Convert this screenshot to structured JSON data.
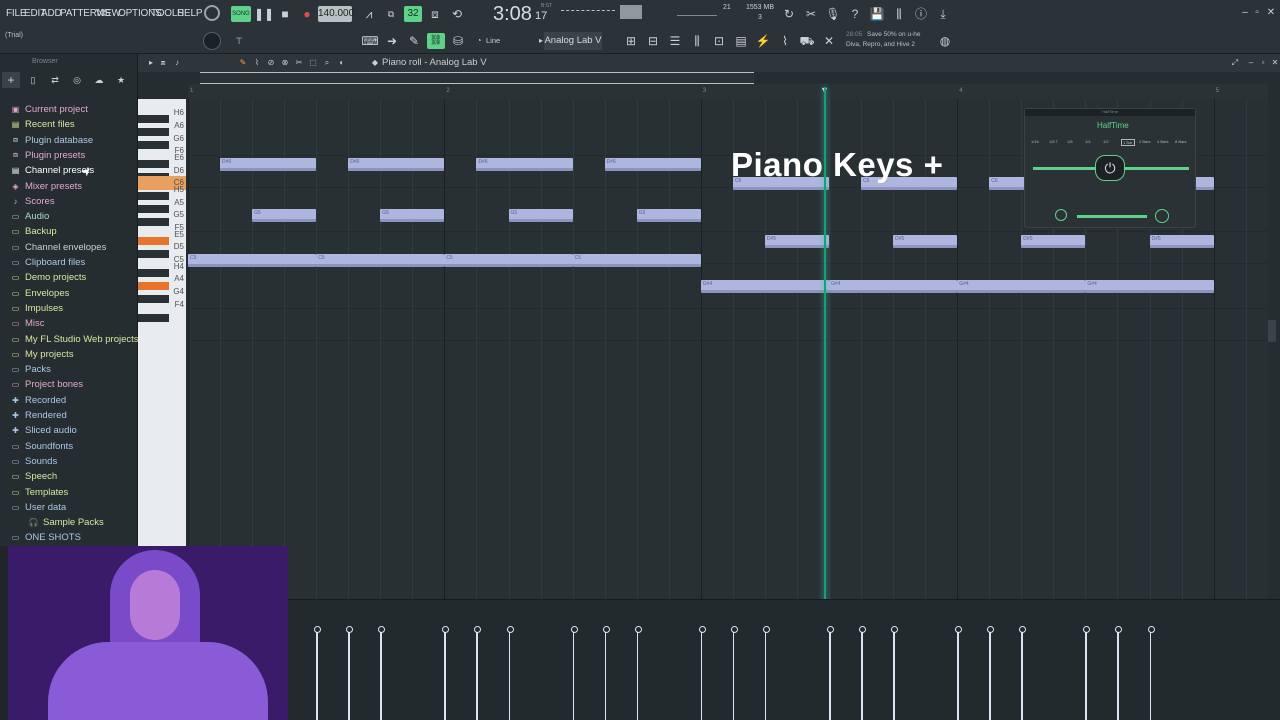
{
  "menu": [
    "FILE",
    "EDIT",
    "ADD",
    "PATTERNS",
    "VIEW",
    "OPTIONS",
    "TOOLS",
    "HELP"
  ],
  "transport": {
    "song_label": "SONG",
    "tempo": "140.000",
    "time": "3:08",
    "time_frac": "17",
    "time_unit": "B:ST",
    "memory": "1553 MB",
    "cpu": "21",
    "poly": "3",
    "snap": "32"
  },
  "trial": "(Trial)",
  "toolbar": {
    "snap_mode": "Line",
    "instrument": "Analog Lab V",
    "hint_time": "28:05",
    "hint_text": "Save 50% on u-he",
    "hint_text2": "Diva, Repro, and Hive 2"
  },
  "browser": {
    "header": "Browser",
    "items": [
      {
        "label": "Current project",
        "icon": "project-icon",
        "color": "#e2a9c8"
      },
      {
        "label": "Recent files",
        "icon": "recent-icon",
        "color": "#d7e6a0"
      },
      {
        "label": "Plugin database",
        "icon": "plug-icon",
        "color": "#a9c8e6"
      },
      {
        "label": "Plugin presets",
        "icon": "plug-icon",
        "color": "#e2a9c8"
      },
      {
        "label": "Channel presets",
        "icon": "channel-icon",
        "color": "#ffffff"
      },
      {
        "label": "Mixer presets",
        "icon": "mixer-icon",
        "color": "#e2a9c8"
      },
      {
        "label": "Scores",
        "icon": "score-icon",
        "color": "#e2a9c8"
      },
      {
        "label": "Audio",
        "icon": "folder-icon",
        "color": "#a9d9c8"
      },
      {
        "label": "Backup",
        "icon": "folder-icon",
        "color": "#d7e6a0"
      },
      {
        "label": "Channel envelopes",
        "icon": "folder-icon",
        "color": "#c8d0d4"
      },
      {
        "label": "Clipboard files",
        "icon": "folder-icon",
        "color": "#a9c8e6"
      },
      {
        "label": "Demo projects",
        "icon": "folder-icon",
        "color": "#d7e6a0"
      },
      {
        "label": "Envelopes",
        "icon": "folder-icon",
        "color": "#d7e6a0"
      },
      {
        "label": "Impulses",
        "icon": "folder-icon",
        "color": "#d7e6a0"
      },
      {
        "label": "Misc",
        "icon": "folder-icon",
        "color": "#e2a9c8"
      },
      {
        "label": "My FL Studio Web projects",
        "icon": "folder-icon",
        "color": "#d7e6a0"
      },
      {
        "label": "My projects",
        "icon": "folder-icon",
        "color": "#d7e6a0"
      },
      {
        "label": "Packs",
        "icon": "folder-icon",
        "color": "#a9c8e6"
      },
      {
        "label": "Project bones",
        "icon": "folder-icon",
        "color": "#e2a9c8"
      },
      {
        "label": "Recorded",
        "icon": "plus-icon",
        "color": "#a9c8e6"
      },
      {
        "label": "Rendered",
        "icon": "plus-icon",
        "color": "#a9c8e6"
      },
      {
        "label": "Sliced audio",
        "icon": "plus-icon",
        "color": "#a9c8e6"
      },
      {
        "label": "Soundfonts",
        "icon": "folder-icon",
        "color": "#a9c8e6"
      },
      {
        "label": "Sounds",
        "icon": "folder-icon",
        "color": "#a9c8e6"
      },
      {
        "label": "Speech",
        "icon": "folder-icon",
        "color": "#d7e6a0"
      },
      {
        "label": "Templates",
        "icon": "folder-icon",
        "color": "#d7e6a0"
      },
      {
        "label": "User data",
        "icon": "folder-icon",
        "color": "#a9c8e6"
      },
      {
        "label": "Sample Packs",
        "icon": "headphones-icon",
        "color": "#d7e6a0"
      },
      {
        "label": "ONE SHOTS",
        "icon": "folder-icon",
        "color": "#a9c8e6"
      }
    ]
  },
  "piano_roll": {
    "title": "Piano roll - Analog Lab V",
    "key_labels": [
      "H6",
      "A6",
      "G6",
      "F6",
      "E6",
      "D6",
      "C6",
      "H5",
      "A5",
      "G5",
      "F5",
      "E5",
      "D5",
      "C5",
      "H4",
      "A4",
      "G4",
      "F4"
    ],
    "bar_numbers": [
      "1",
      "2",
      "3",
      "4",
      "5"
    ],
    "notes": [
      {
        "pitch": "D#6",
        "start": 1.25,
        "end": 2.0
      },
      {
        "pitch": "D#6",
        "start": 2.25,
        "end": 3.0
      },
      {
        "pitch": "D#6",
        "start": 3.25,
        "end": 4.0
      },
      {
        "pitch": "D#6",
        "start": 4.25,
        "end": 5.0
      },
      {
        "pitch": "G5",
        "start": 1.5,
        "end": 2.0
      },
      {
        "pitch": "G5",
        "start": 2.5,
        "end": 3.0
      },
      {
        "pitch": "G5",
        "start": 3.5,
        "end": 4.0
      },
      {
        "pitch": "G5",
        "start": 4.5,
        "end": 5.0
      },
      {
        "pitch": "C5",
        "start": 1.0,
        "end": 2.0
      },
      {
        "pitch": "C5",
        "start": 2.0,
        "end": 3.0
      },
      {
        "pitch": "C5",
        "start": 3.0,
        "end": 4.0
      },
      {
        "pitch": "C5",
        "start": 4.0,
        "end": 5.0
      },
      {
        "pitch": "C6",
        "start": 5.25,
        "end": 6.0
      },
      {
        "pitch": "C6",
        "start": 6.25,
        "end": 7.0
      },
      {
        "pitch": "C6",
        "start": 7.25,
        "end": 8.0
      },
      {
        "pitch": "C6",
        "start": 8.25,
        "end": 9.0
      },
      {
        "pitch": "D#5",
        "start": 5.5,
        "end": 6.0
      },
      {
        "pitch": "D#5",
        "start": 6.5,
        "end": 7.0
      },
      {
        "pitch": "D#5",
        "start": 7.5,
        "end": 8.0
      },
      {
        "pitch": "D#5",
        "start": 8.5,
        "end": 9.0
      },
      {
        "pitch": "G#4",
        "start": 5.0,
        "end": 6.0
      },
      {
        "pitch": "G#4",
        "start": 6.0,
        "end": 7.0
      },
      {
        "pitch": "G#4",
        "start": 7.0,
        "end": 8.0
      },
      {
        "pitch": "G#4",
        "start": 8.0,
        "end": 9.0
      }
    ]
  },
  "overlay": {
    "title": "Piano Keys +"
  },
  "plugin": {
    "name": "HalfTime",
    "brand": "HalfTime",
    "rates": [
      "1/16",
      "1/8 T",
      "1/8",
      "1/4",
      "1/2",
      "1 Bar",
      "2 Bars",
      "4 Bars",
      "8 Bars"
    ]
  }
}
